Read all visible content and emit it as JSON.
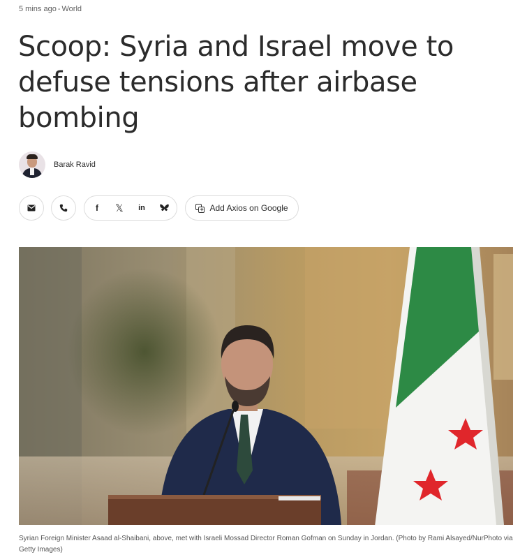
{
  "meta": {
    "time": "5 mins ago",
    "separator": "-",
    "section": "World"
  },
  "headline": "Scoop: Syria and Israel move to defuse tensions after airbase bombing",
  "byline": {
    "author": "Barak Ravid"
  },
  "share": {
    "email_icon": "email-icon",
    "phone_icon": "phone-icon",
    "facebook_glyph": "f",
    "x_glyph": "𝕏",
    "linkedin_glyph": "in",
    "bluesky_glyph": "🦋",
    "google_label": "Add Axios on Google"
  },
  "photo": {
    "description_icon": "photo-press-conference"
  },
  "caption": "Syrian Foreign Minister Asaad al-Shaibani, above, met with Israeli Mossad Director Roman Gofman on Sunday in Jordan. (Photo by Rami Alsayed/NurPhoto via Getty Images)",
  "colors": {
    "headline": "#2b2b2b",
    "flag_green": "#2d8a45",
    "flag_red": "#e0262b"
  }
}
